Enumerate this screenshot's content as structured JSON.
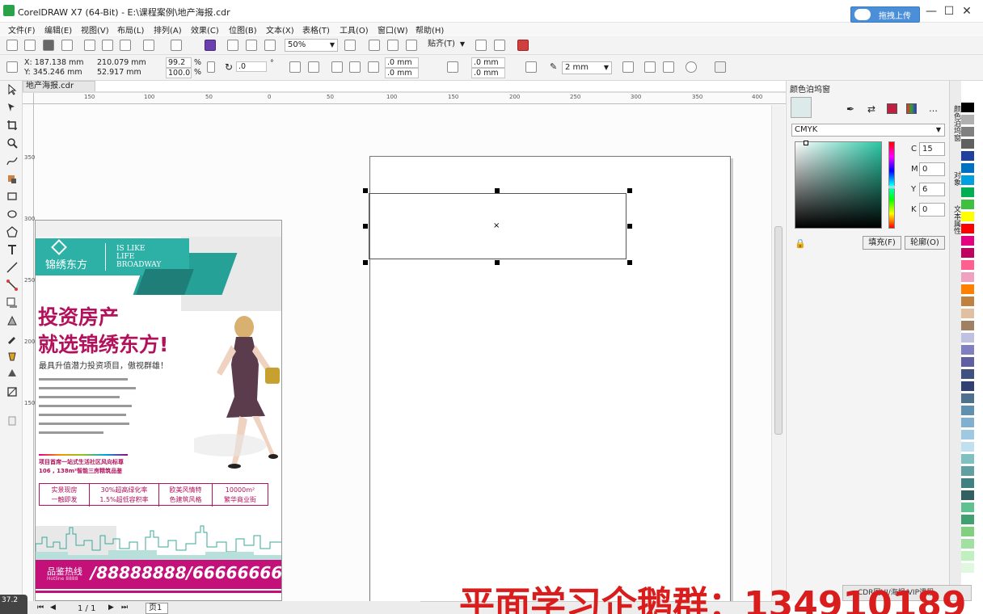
{
  "window": {
    "title": "CorelDRAW X7 (64-Bit) - E:\\课程案例\\地产海报.cdr",
    "upload_label": "拖拽上传"
  },
  "menu": [
    "文件(F)",
    "编辑(E)",
    "视图(V)",
    "布局(L)",
    "排列(A)",
    "效果(C)",
    "位图(B)",
    "文本(X)",
    "表格(T)",
    "工具(O)",
    "窗口(W)",
    "帮助(H)"
  ],
  "toolbar": {
    "zoom_value": "50%",
    "snap_label": "贴齐(T)"
  },
  "property_bar": {
    "x": "X: 187.138 mm",
    "y": "Y: 345.246 mm",
    "width": "210.079 mm",
    "height": "52.917 mm",
    "scale_w": "99.2",
    "scale_h": "100.0",
    "percent": "%",
    "rotation": ".0",
    "degree": "°",
    "corner_1": ".0 mm",
    "corner_2": ".0 mm",
    "corner_3": ".0 mm",
    "corner_4": ".0 mm",
    "outline_width": "2 mm"
  },
  "document": {
    "tab_label": "地产海报.cdr",
    "ruler_units_h": [
      "150",
      "100",
      "50",
      "0",
      "50",
      "100",
      "150",
      "200",
      "250",
      "300",
      "350",
      "400"
    ],
    "ruler_units_v": [
      "350",
      "300",
      "250",
      "200",
      "150"
    ]
  },
  "poster": {
    "slogan": "IS LIKE\nLIFE\nBROADWAY",
    "brand": "锦绣东方",
    "headline1": "投资房产",
    "headline2": "就选锦绣东方!",
    "subline": "最具升值潜力投资项目，傲视群雄！",
    "highlight1": "项目首席一站式生活社区风向标尊",
    "highlight2": "106 , 138m²智能三房精筑品鉴",
    "features": [
      {
        "top": "实景现房",
        "bottom": "一触即发"
      },
      {
        "top": "30%超高绿化率",
        "bottom": "1.5%超低容积率"
      },
      {
        "top": "欧美风情特",
        "bottom": "色建筑风格"
      },
      {
        "top": "10000m²",
        "bottom": "繁华商业街"
      }
    ],
    "hotline_label": "品鉴热线",
    "hotline_sub": "Hotline 8888",
    "hotline_number": "/88888888/66666666"
  },
  "docker": {
    "title": "颜色泊坞窗",
    "model": "CMYK",
    "values": [
      {
        "label": "C",
        "value": "15"
      },
      {
        "label": "M",
        "value": "0"
      },
      {
        "label": "Y",
        "value": "6"
      },
      {
        "label": "K",
        "value": "0"
      }
    ],
    "fill_button": "填充(F)",
    "outline_button": "轮廓(O)",
    "side_tabs": [
      "颜色泊坞窗",
      "对象",
      "文本属性"
    ]
  },
  "palette": [
    "#ffffff",
    "#000000",
    "#b0b0b0",
    "#808080",
    "#606060",
    "#2040a0",
    "#0070c0",
    "#00a0e0",
    "#00b050",
    "#40c040",
    "#ffff00",
    "#ff0000",
    "#e4007f",
    "#c00060",
    "#ff6090",
    "#f0a0c0",
    "#ff8000",
    "#c08040",
    "#e0c0a0",
    "#a08060",
    "#c0c0e0",
    "#8080c0",
    "#6060a0",
    "#405080",
    "#304070",
    "#507090",
    "#6090b0",
    "#80b0d0",
    "#a0c8e0",
    "#c0e0f0",
    "#80c0c0",
    "#60a0a0",
    "#408080",
    "#306060",
    "#60c090",
    "#40a070",
    "#80d080",
    "#a0e0a0",
    "#c0f0c0",
    "#e0f8e0"
  ],
  "status": {
    "zoom": "37.2",
    "page": "1 / 1",
    "page_tab": "页1"
  },
  "overlay": {
    "watermark": "平面学习企鹅群：134910189",
    "cd_label": "CDR同UI/海报/VIP课程"
  }
}
